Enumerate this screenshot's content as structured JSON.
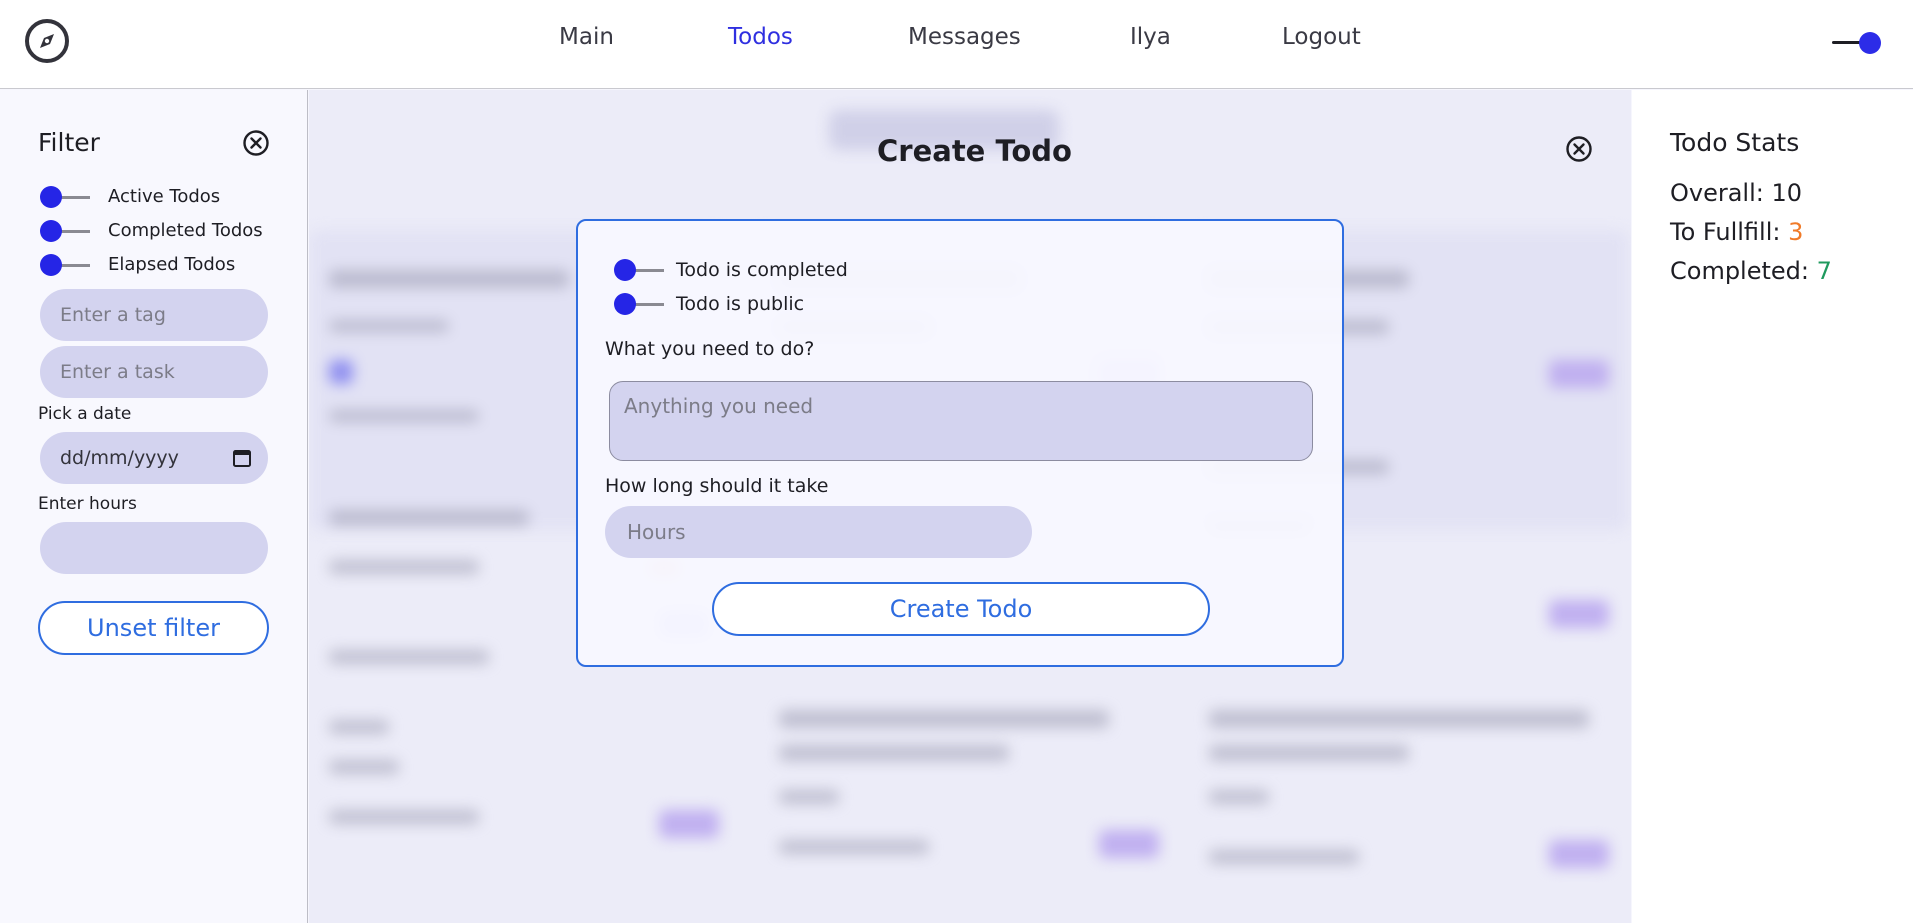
{
  "nav": {
    "items": [
      {
        "label": "Main"
      },
      {
        "label": "Todos",
        "active": true
      },
      {
        "label": "Messages"
      },
      {
        "label": "Ilya"
      },
      {
        "label": "Logout"
      }
    ]
  },
  "icons": {
    "logo": "compass-icon",
    "theme": "theme-toggle",
    "close": "close-circle-icon",
    "calendar": "calendar-icon"
  },
  "filter": {
    "title": "Filter",
    "toggles": [
      {
        "label": "Active Todos",
        "on": false
      },
      {
        "label": "Completed Todos",
        "on": false
      },
      {
        "label": "Elapsed Todos",
        "on": false
      }
    ],
    "tag_placeholder": "Enter a tag",
    "task_placeholder": "Enter a task",
    "date_label": "Pick a date",
    "date_placeholder": "dd/mm/yyyy",
    "hours_label": "Enter hours",
    "hours_value": "",
    "unset_button": "Unset filter"
  },
  "modal": {
    "title": "Create Todo",
    "toggles": [
      {
        "label": "Todo is completed",
        "on": false
      },
      {
        "label": "Todo is public",
        "on": false
      }
    ],
    "task_label": "What you need to do?",
    "task_placeholder": "Anything you need",
    "duration_label": "How long should it take",
    "duration_placeholder": "Hours",
    "submit_button": "Create Todo"
  },
  "stats": {
    "title": "Todo Stats",
    "overall_label": "Overall:",
    "overall_value": "10",
    "to_fulfill_label": "To Fullfill:",
    "to_fulfill_value": "3",
    "completed_label": "Completed:",
    "completed_value": "7"
  },
  "colors": {
    "accent": "#2f6de0",
    "nav_active": "#2f2fe0",
    "toggle_knob": "#2525e6",
    "input_bg": "#d3d3ef",
    "to_fulfill": "#f07a28",
    "completed": "#1f9a5e"
  }
}
